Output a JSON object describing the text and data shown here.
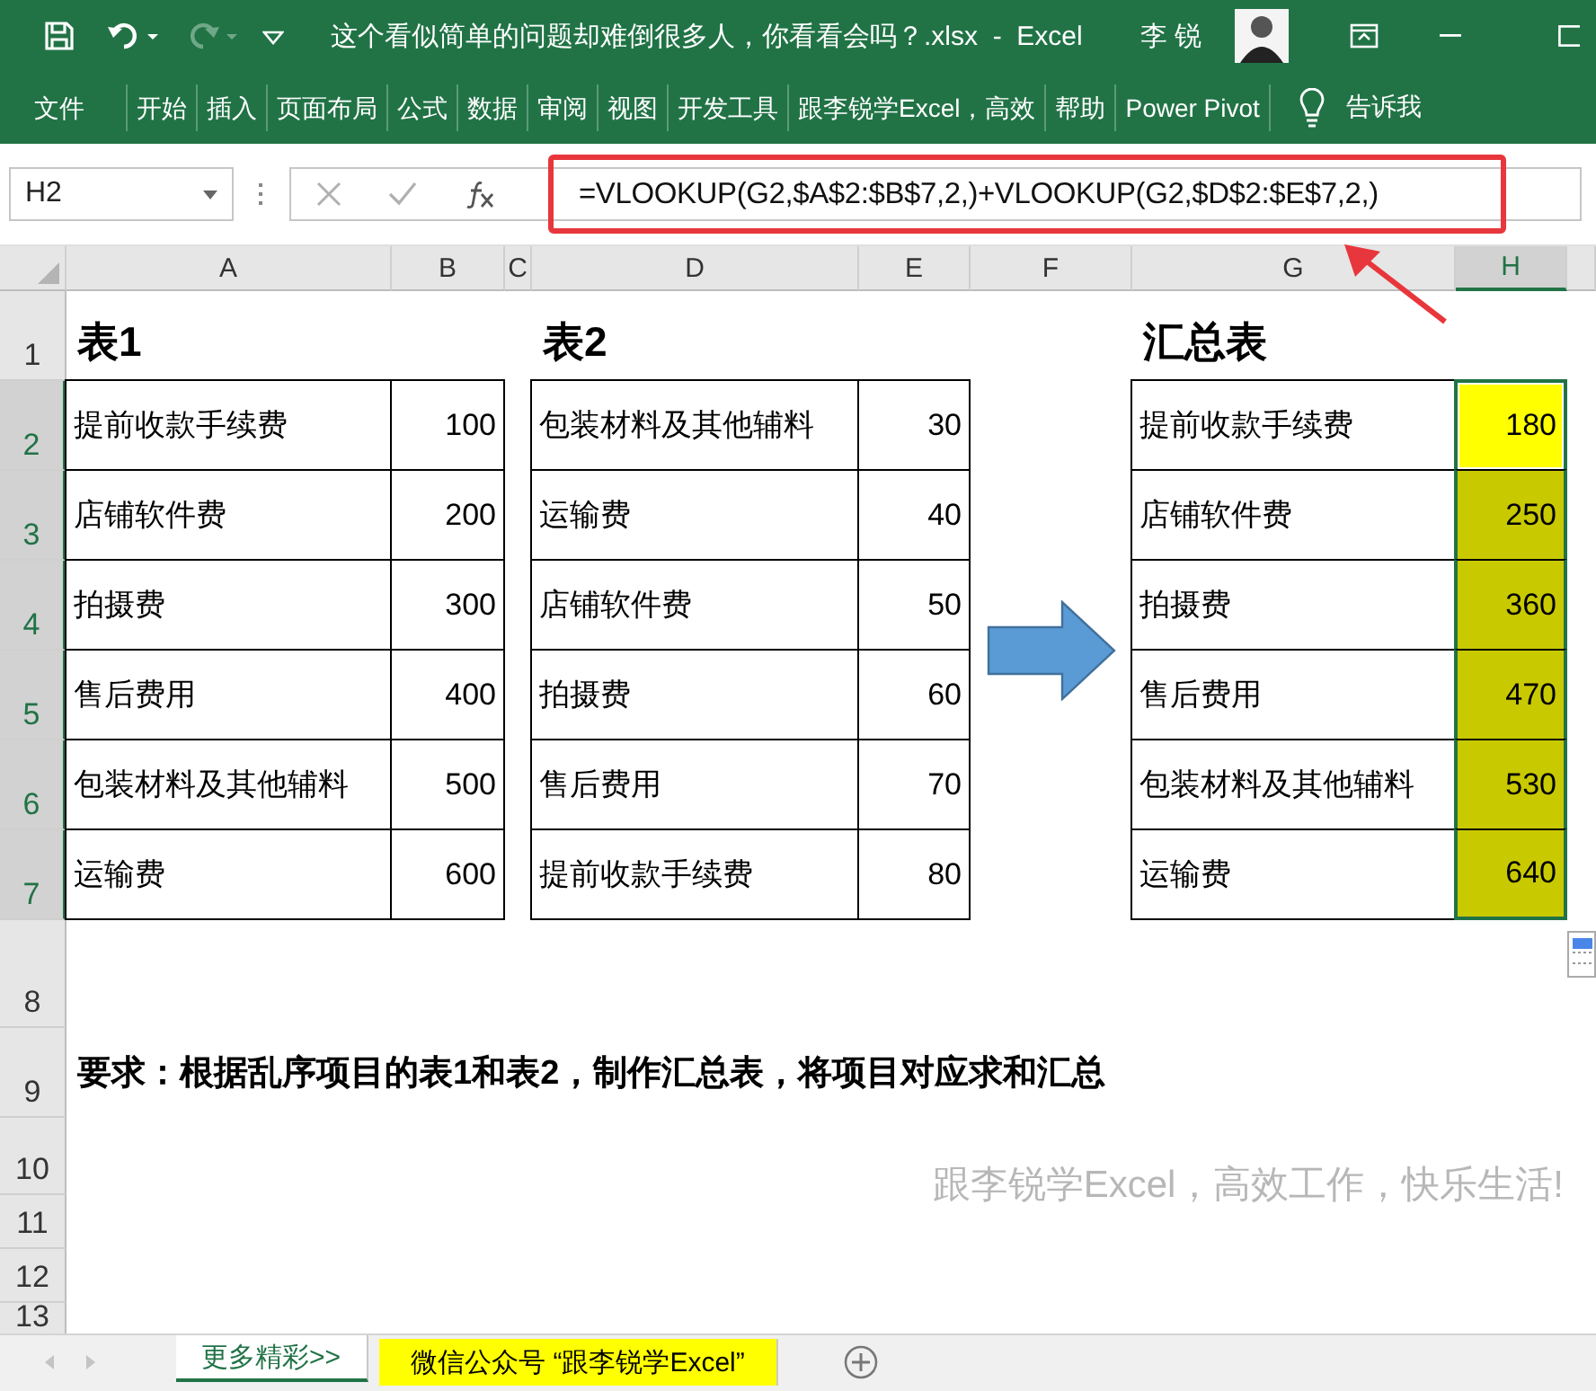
{
  "title_bar": {
    "title": "这个看似简单的问题却难倒很多人，你看看会吗？.xlsx  -  Excel",
    "user": "李 锐"
  },
  "ribbon_tabs": [
    {
      "label": "文件",
      "selected": false
    },
    {
      "label": "开始",
      "selected": false
    },
    {
      "label": "插入",
      "selected": false
    },
    {
      "label": "页面布局",
      "selected": false
    },
    {
      "label": "公式",
      "selected": false
    },
    {
      "label": "数据",
      "selected": false
    },
    {
      "label": "审阅",
      "selected": false
    },
    {
      "label": "视图",
      "selected": false
    },
    {
      "label": "开发工具",
      "selected": false
    },
    {
      "label": "跟李锐学Excel，高效",
      "selected": false
    },
    {
      "label": "帮助",
      "selected": false
    },
    {
      "label": "Power Pivot",
      "selected": false
    }
  ],
  "tell_me": "告诉我",
  "formula_bar": {
    "name_box": "H2",
    "formula": "=VLOOKUP(G2,$A$2:$B$7,2,)+VLOOKUP(G2,$D$2:$E$7,2,)"
  },
  "columns": [
    {
      "label": "A",
      "selected": false
    },
    {
      "label": "B",
      "selected": false
    },
    {
      "label": "C",
      "selected": false
    },
    {
      "label": "D",
      "selected": false
    },
    {
      "label": "E",
      "selected": false
    },
    {
      "label": "F",
      "selected": false
    },
    {
      "label": "G",
      "selected": false
    },
    {
      "label": "H",
      "selected": true
    }
  ],
  "rows": [
    {
      "label": "1",
      "selected": false
    },
    {
      "label": "2",
      "selected": true
    },
    {
      "label": "3",
      "selected": true
    },
    {
      "label": "4",
      "selected": true
    },
    {
      "label": "5",
      "selected": true
    },
    {
      "label": "6",
      "selected": true
    },
    {
      "label": "7",
      "selected": true
    },
    {
      "label": "8",
      "selected": false
    },
    {
      "label": "9",
      "selected": false
    },
    {
      "label": "10",
      "selected": false
    },
    {
      "label": "11",
      "selected": false
    },
    {
      "label": "12",
      "selected": false
    },
    {
      "label": "13",
      "selected": false
    }
  ],
  "table1": {
    "title": "表1",
    "rows": [
      {
        "item": "提前收款手续费",
        "amount": "100"
      },
      {
        "item": "店铺软件费",
        "amount": "200"
      },
      {
        "item": "拍摄费",
        "amount": "300"
      },
      {
        "item": "售后费用",
        "amount": "400"
      },
      {
        "item": "包装材料及其他辅料",
        "amount": "500"
      },
      {
        "item": "运输费",
        "amount": "600"
      }
    ]
  },
  "table2": {
    "title": "表2",
    "rows": [
      {
        "item": "包装材料及其他辅料",
        "amount": "30"
      },
      {
        "item": "运输费",
        "amount": "40"
      },
      {
        "item": "店铺软件费",
        "amount": "50"
      },
      {
        "item": "拍摄费",
        "amount": "60"
      },
      {
        "item": "售后费用",
        "amount": "70"
      },
      {
        "item": "提前收款手续费",
        "amount": "80"
      }
    ]
  },
  "summary": {
    "title": "汇总表",
    "rows": [
      {
        "item": "提前收款手续费",
        "total": "180",
        "selected": true,
        "active": true
      },
      {
        "item": "店铺软件费",
        "total": "250",
        "selected": true,
        "active": false
      },
      {
        "item": "拍摄费",
        "total": "360",
        "selected": true,
        "active": false
      },
      {
        "item": "售后费用",
        "total": "470",
        "selected": true,
        "active": false
      },
      {
        "item": "包装材料及其他辅料",
        "total": "530",
        "selected": true,
        "active": false
      },
      {
        "item": "运输费",
        "total": "640",
        "selected": true,
        "active": false
      }
    ]
  },
  "requirement": "要求：根据乱序项目的表1和表2，制作汇总表，将项目对应求和汇总",
  "footer_note": "跟李锐学Excel，高效工作，快乐生活!",
  "sheet_tabs": [
    {
      "label": "更多精彩>>",
      "selected": true
    },
    {
      "label": "微信公众号 “跟李锐学Excel”",
      "selected": false,
      "color": "#ffff00"
    }
  ]
}
